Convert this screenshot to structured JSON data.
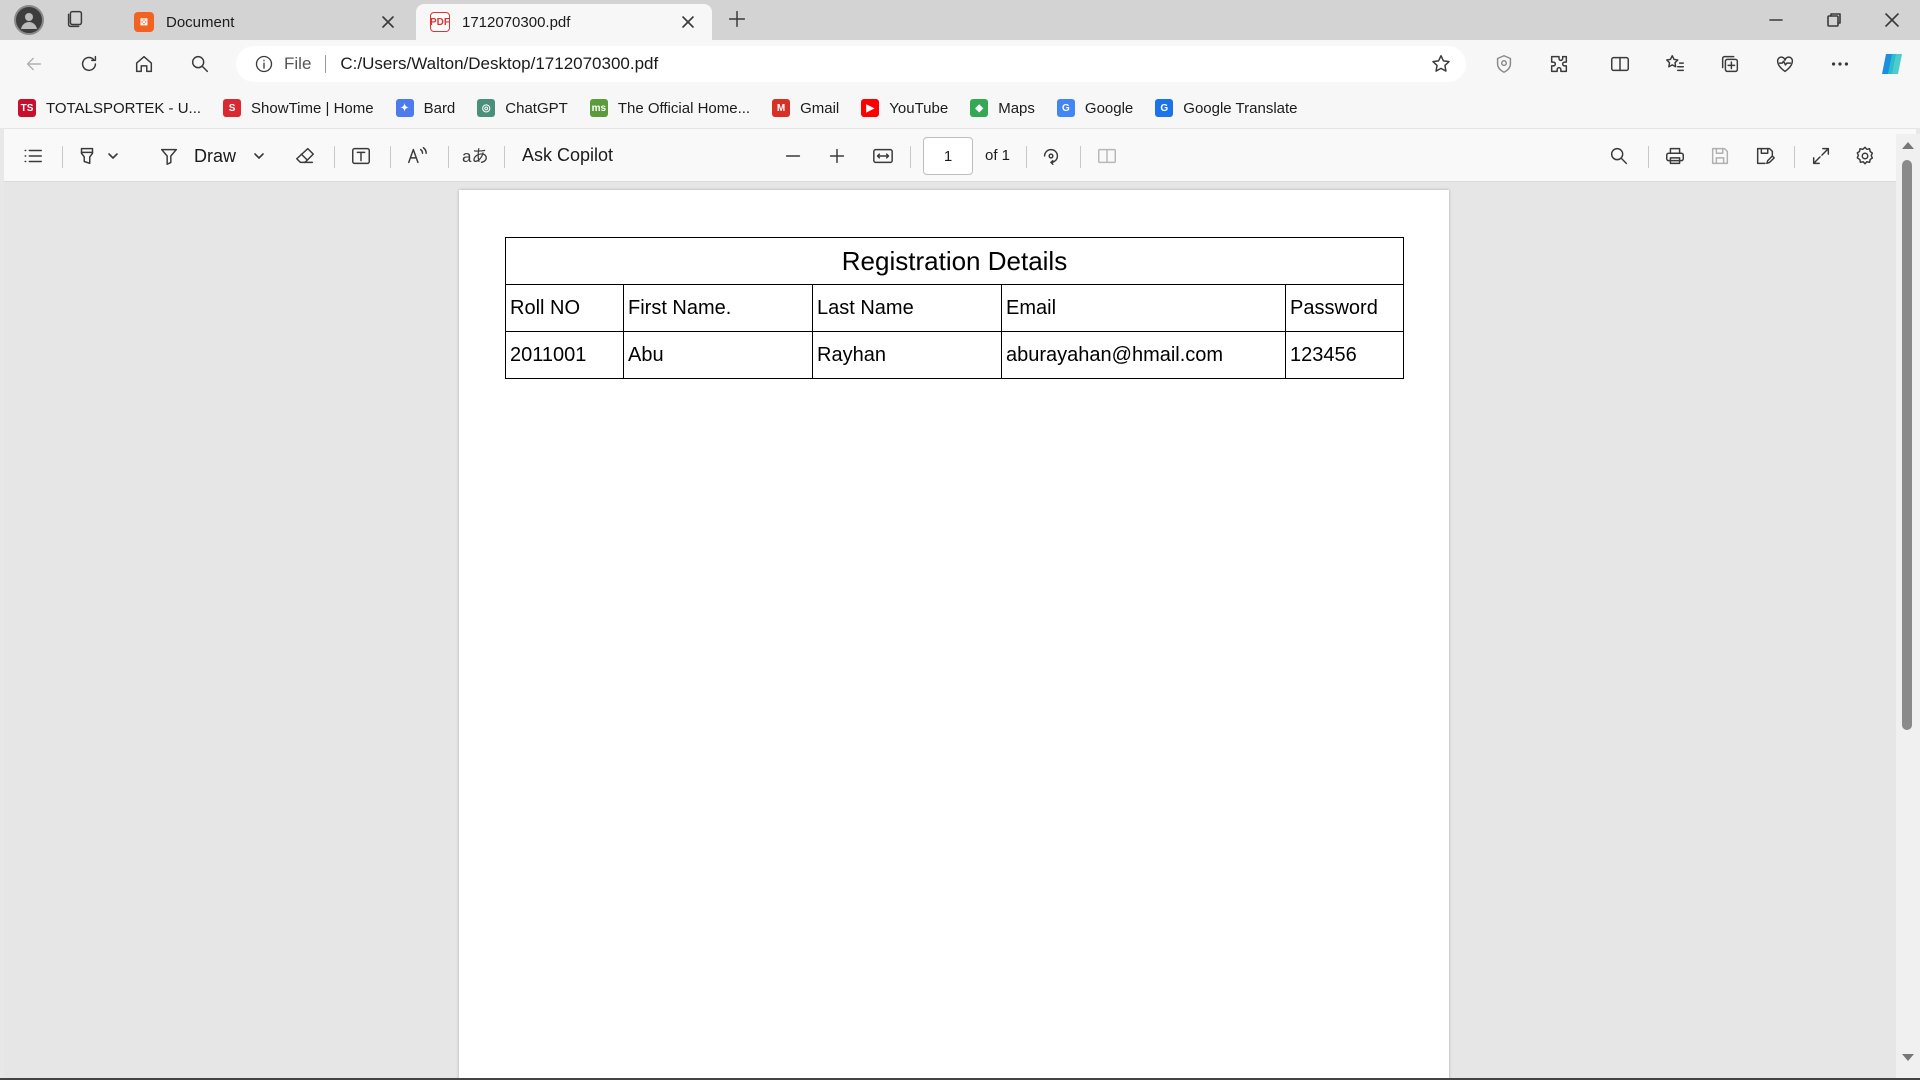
{
  "tabs": [
    {
      "title": "Document",
      "favicon": "xampp-icon",
      "active": false
    },
    {
      "title": "1712070300.pdf",
      "favicon": "pdf-icon",
      "active": true
    }
  ],
  "address": {
    "scheme": "File",
    "url": "C:/Users/Walton/Desktop/1712070300.pdf"
  },
  "bookmarks": [
    {
      "label": "TOTALSPORTEK - U...",
      "icon": "totalsportek-icon",
      "icon_text": "TS",
      "color": "#c8102e"
    },
    {
      "label": "ShowTime | Home",
      "icon": "showtime-icon",
      "icon_text": "S",
      "color": "#d9282f"
    },
    {
      "label": "Bard",
      "icon": "bard-icon",
      "icon_text": "✦",
      "color": "#4b7bec"
    },
    {
      "label": "ChatGPT",
      "icon": "chatgpt-icon",
      "icon_text": "◎",
      "color": "#4a8f7a"
    },
    {
      "label": "The Official Home...",
      "icon": "official-home-icon",
      "icon_text": "ms",
      "color": "#5b9b3b"
    },
    {
      "label": "Gmail",
      "icon": "gmail-icon",
      "icon_text": "M",
      "color": "#d93025"
    },
    {
      "label": "YouTube",
      "icon": "youtube-icon",
      "icon_text": "▶",
      "color": "#ff0000"
    },
    {
      "label": "Maps",
      "icon": "maps-icon",
      "icon_text": "◆",
      "color": "#34a853"
    },
    {
      "label": "Google",
      "icon": "google-icon",
      "icon_text": "G",
      "color": "#4285f4"
    },
    {
      "label": "Google Translate",
      "icon": "google-translate-icon",
      "icon_text": "G",
      "color": "#1a73e8"
    }
  ],
  "pdf_toolbar": {
    "draw_label": "Draw",
    "copilot_label": "Ask Copilot",
    "page_current": "1",
    "page_of": "of 1"
  },
  "document": {
    "caption": "Registration Details",
    "headers": [
      "Roll NO",
      "First Name.",
      "Last Name",
      "Email",
      "Password"
    ],
    "rows": [
      [
        "2011001",
        "Abu",
        "Rayhan",
        "aburayahan@hmail.com",
        "123456"
      ]
    ]
  },
  "colors": {
    "tabstrip": "#d3d3d3",
    "toolbar": "#f7f7f7",
    "viewer_bg": "#e6e6e6",
    "page": "#ffffff"
  }
}
